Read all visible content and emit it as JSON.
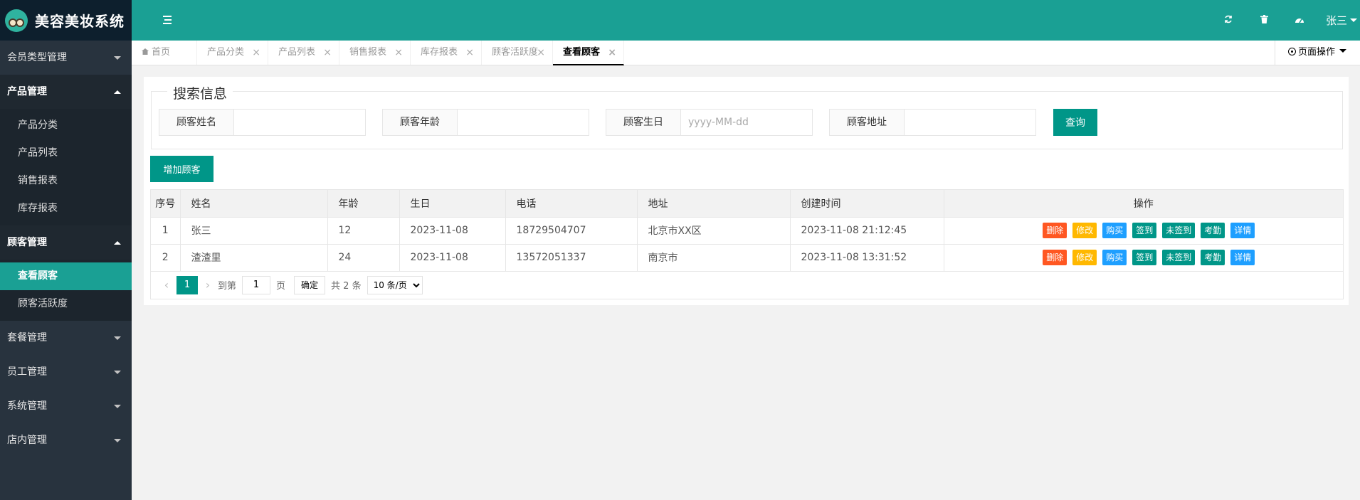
{
  "app": {
    "title": "美容美妆系统"
  },
  "header": {
    "user": "张三"
  },
  "sidebar": {
    "groups": [
      {
        "label": "会员类型管理",
        "open": false,
        "items": []
      },
      {
        "label": "产品管理",
        "open": true,
        "items": [
          "产品分类",
          "产品列表",
          "销售报表",
          "库存报表"
        ]
      },
      {
        "label": "顾客管理",
        "open": true,
        "items": [
          "查看顾客",
          "顾客活跃度"
        ]
      },
      {
        "label": "套餐管理",
        "open": false,
        "items": []
      },
      {
        "label": "员工管理",
        "open": false,
        "items": []
      },
      {
        "label": "系统管理",
        "open": false,
        "items": []
      },
      {
        "label": "店内管理",
        "open": false,
        "items": []
      }
    ],
    "active_item": "查看顾客"
  },
  "tabs": [
    {
      "label": "首页",
      "home": true
    },
    {
      "label": "产品分类"
    },
    {
      "label": "产品列表"
    },
    {
      "label": "销售报表"
    },
    {
      "label": "库存报表"
    },
    {
      "label": "顾客活跃度"
    },
    {
      "label": "查看顾客",
      "active": true
    }
  ],
  "tabs_close_glyph": "×",
  "page_ops": "页面操作",
  "search": {
    "legend": "搜索信息",
    "fields": [
      {
        "label": "顾客姓名",
        "value": "",
        "placeholder": ""
      },
      {
        "label": "顾客年龄",
        "value": "",
        "placeholder": ""
      },
      {
        "label": "顾客生日",
        "value": "",
        "placeholder": "yyyy-MM-dd"
      },
      {
        "label": "顾客地址",
        "value": "",
        "placeholder": ""
      }
    ],
    "query_button": "查询"
  },
  "add_button": "增加顾客",
  "table": {
    "headers": [
      "序号",
      "姓名",
      "年龄",
      "生日",
      "电话",
      "地址",
      "创建时间",
      "操作"
    ],
    "rows": [
      {
        "index": "1",
        "name": "张三",
        "age": "12",
        "birthday": "2023-11-08",
        "phone": "18729504707",
        "address": "北京市XX区",
        "created": "2023-11-08 21:12:45"
      },
      {
        "index": "2",
        "name": "渣渣里",
        "age": "24",
        "birthday": "2023-11-08",
        "phone": "13572051337",
        "address": "南京市",
        "created": "2023-11-08 13:31:52"
      }
    ],
    "actions": [
      {
        "label": "删除",
        "color": "#ff5722"
      },
      {
        "label": "修改",
        "color": "#ffb800"
      },
      {
        "label": "购买",
        "color": "#1e9fff"
      },
      {
        "label": "签到",
        "color": "#009688"
      },
      {
        "label": "未签到",
        "color": "#009688"
      },
      {
        "label": "考勤",
        "color": "#009688"
      },
      {
        "label": "详情",
        "color": "#1e9fff"
      }
    ]
  },
  "pager": {
    "current_page": "1",
    "goto_prefix": "到第",
    "goto_value": "1",
    "goto_suffix": "页",
    "confirm": "确定",
    "total": "共 2 条",
    "page_size": "10 条/页"
  },
  "colors": {
    "primary": "#1aa094",
    "sidebar_bg": "#28333e",
    "logo_bg": "#0d1f2d",
    "button": "#009688"
  }
}
